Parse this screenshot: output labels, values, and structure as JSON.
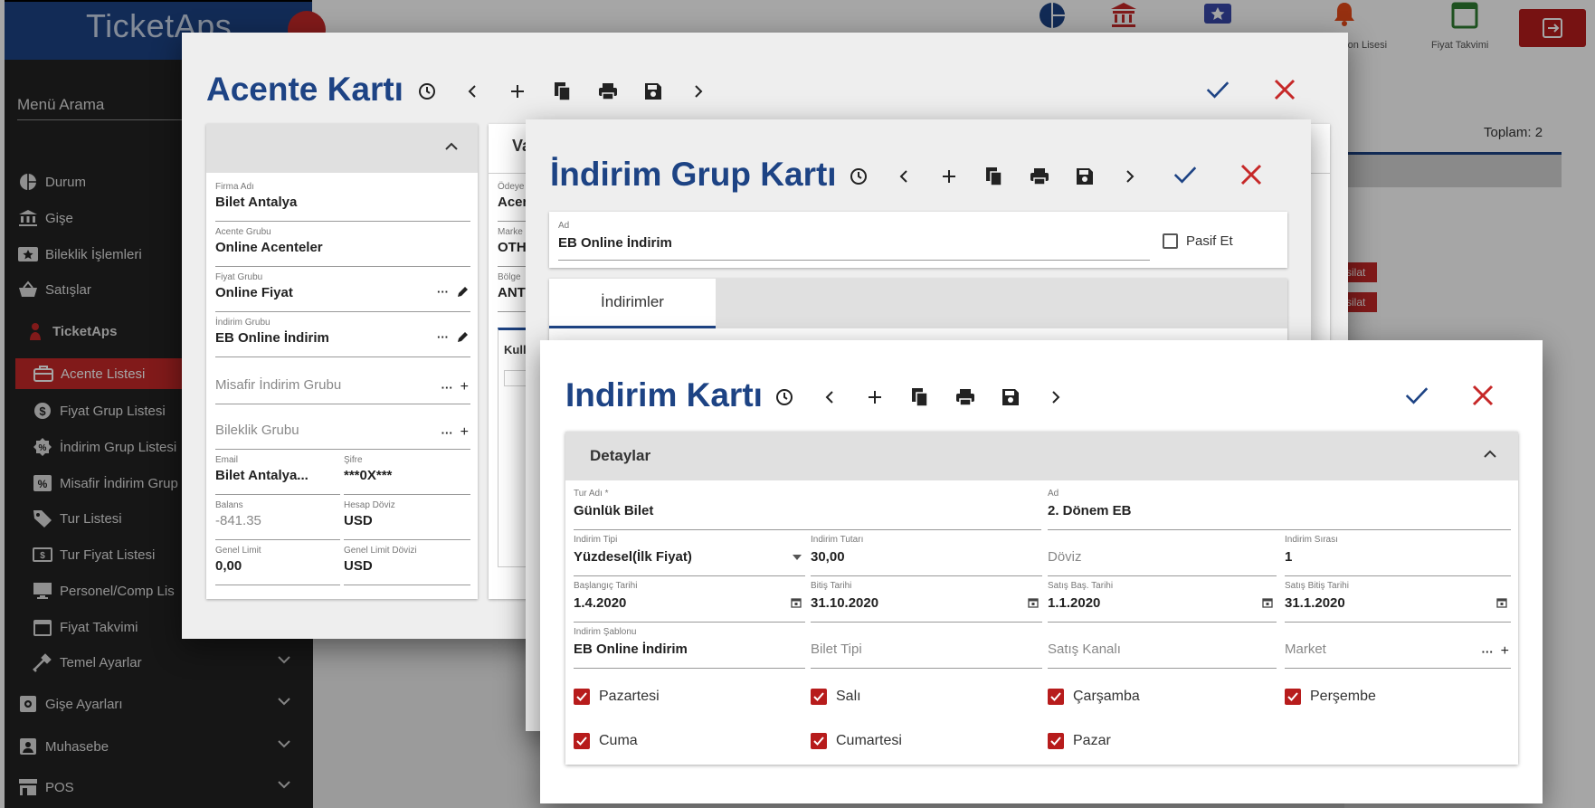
{
  "app": {
    "logo": "TicketAps"
  },
  "top": {
    "items": [
      {
        "label": "",
        "icon": "pie-chart-icon"
      },
      {
        "label": "",
        "icon": "bank-icon"
      },
      {
        "label": "",
        "icon": "ticket-star-icon"
      },
      {
        "label": "ron Lisesi",
        "icon": "bell-icon"
      },
      {
        "label": "Fiyat Takvimi",
        "icon": "calendar-icon"
      }
    ],
    "exit_icon": "exit-icon"
  },
  "background": {
    "toplam": "Toplam: 2",
    "tahsilat": "silat"
  },
  "sidebar": {
    "search": "Menü Arama",
    "items": [
      {
        "label": "Durum",
        "icon": "pie-chart-icon"
      },
      {
        "label": "Gişe",
        "icon": "bank-icon"
      },
      {
        "label": "Bileklik İşlemleri",
        "icon": "ticket-star-icon"
      },
      {
        "label": "Satışlar",
        "icon": "basket-icon"
      },
      {
        "label": "TicketAps",
        "icon": "person-icon"
      },
      {
        "label": "Acente Listesi",
        "icon": "briefcase-icon"
      },
      {
        "label": "Fiyat Grup Listesi",
        "icon": "dollar-icon"
      },
      {
        "label": "İndirim Grup Listesi",
        "icon": "discount-badge-icon"
      },
      {
        "label": "Misafir İndirim Grup",
        "icon": "percent-icon"
      },
      {
        "label": "Tur Listesi",
        "icon": "tag-icon"
      },
      {
        "label": "Tur Fiyat Listesi",
        "icon": "price-icon"
      },
      {
        "label": "Personel/Comp Lis",
        "icon": "monitor-icon"
      },
      {
        "label": "Fiyat Takvimi",
        "icon": "calendar-icon"
      },
      {
        "label": "Temel Ayarlar",
        "icon": "tools-icon"
      },
      {
        "label": "Gişe Ayarları",
        "icon": "settings-box-icon"
      },
      {
        "label": "Muhasebe",
        "icon": "account-box-icon"
      },
      {
        "label": "POS",
        "icon": "store-icon"
      }
    ]
  },
  "acente": {
    "title": "Acente Kartı",
    "tab_partial": "Va",
    "fields": [
      {
        "label": "Firma Adı",
        "value": "Bilet Antalya"
      },
      {
        "label": "Acente Grubu",
        "value": "Online Acenteler"
      },
      {
        "label": "Fiyat Grubu",
        "value": "Online Fiyat"
      },
      {
        "label": "İndirim Grubu",
        "value": "EB Online İndirim"
      },
      {
        "label": "",
        "placeholder": "Misafir İndirim Grubu"
      },
      {
        "label": "",
        "placeholder": "Bileklik Grubu"
      },
      {
        "label": "Email",
        "value": "Bilet Antalya..."
      },
      {
        "label": "Şifre",
        "value": "***0X***"
      },
      {
        "label": "Balans",
        "value": "-841.35"
      },
      {
        "label": "Hesap Döviz",
        "value": "USD"
      },
      {
        "label": "Genel Limit",
        "value": "0,00"
      },
      {
        "label": "Genel Limit Dövizi",
        "value": "USD"
      }
    ],
    "right_col": [
      {
        "label": "Ödeye",
        "value": "Acen"
      },
      {
        "label": "Marke",
        "value": "OTH"
      },
      {
        "label": "Bölge",
        "value": "ANT"
      }
    ],
    "kull": "Kull"
  },
  "grup": {
    "title": "İndirim Grup Kartı",
    "ad_label": "Ad",
    "ad_value": "EB Online İndirim",
    "pasif": "Pasif Et",
    "tab": "İndirimler"
  },
  "indirim": {
    "title": "Indirim Kartı",
    "section": "Detaylar",
    "fields": {
      "tur_adi": {
        "label": "Tur Adı *",
        "value": "Günlük Bilet"
      },
      "ad": {
        "label": "Ad",
        "value": "2. Dönem EB"
      },
      "tipi": {
        "label": "Indirim Tipi",
        "value": "Yüzdesel(İlk Fiyat)"
      },
      "tutar": {
        "label": "Indirim Tutarı",
        "value": "30,00"
      },
      "doviz": {
        "placeholder": "Döviz"
      },
      "sira": {
        "label": "Indirim Sırası",
        "value": "1"
      },
      "baslangic": {
        "label": "Başlangıç Tarihi",
        "value": "1.4.2020"
      },
      "bitis": {
        "label": "Bitiş Tarihi",
        "value": "31.10.2020"
      },
      "satis_bas": {
        "label": "Satış Baş. Tarihi",
        "value": "1.1.2020"
      },
      "satis_bitis": {
        "label": "Satış Bitiş Tarihi",
        "value": "31.1.2020"
      },
      "sablon": {
        "label": "Indirim Şablonu",
        "value": "EB Online İndirim"
      },
      "bilet_tipi": {
        "placeholder": "Bilet Tipi"
      },
      "satis_kanali": {
        "placeholder": "Satış Kanalı"
      },
      "market": {
        "placeholder": "Market"
      }
    },
    "days": [
      "Pazartesi",
      "Salı",
      "Çarşamba",
      "Perşembe",
      "Cuma",
      "Cumartesi",
      "Pazar"
    ]
  },
  "colors": {
    "primary": "#1d4384",
    "danger": "#c62828",
    "sidebar": "#222222"
  }
}
